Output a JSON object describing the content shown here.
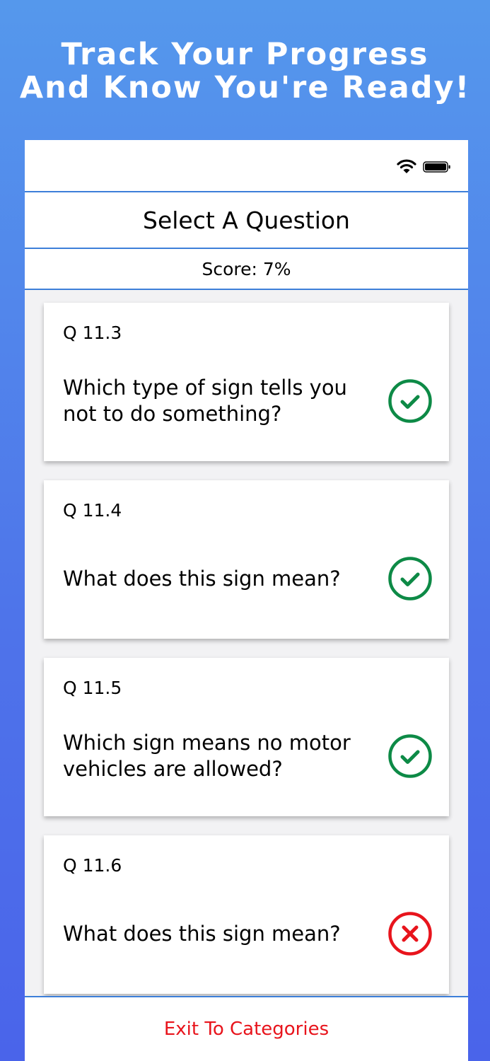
{
  "promo": {
    "headline_line1": "Track Your Progress",
    "headline_line2": "And Know You're Ready!"
  },
  "status_bar": {
    "wifi_icon": "wifi-icon",
    "battery_icon": "battery-icon"
  },
  "header": {
    "title": "Select A Question"
  },
  "score": {
    "text": "Score: 7%"
  },
  "questions": [
    {
      "number": "Q 11.3",
      "line1": "Which type of sign tells you",
      "line2": "not to do something?",
      "result": "correct"
    },
    {
      "number": "Q 11.4",
      "line1": "What does this sign mean?",
      "line2": "",
      "result": "correct"
    },
    {
      "number": "Q 11.5",
      "line1": "Which sign means no motor",
      "line2": "vehicles are allowed?",
      "result": "correct"
    },
    {
      "number": "Q 11.6",
      "line1": "What does this sign mean?",
      "line2": "",
      "result": "incorrect"
    }
  ],
  "footer": {
    "exit_label": "Exit To Categories"
  },
  "colors": {
    "accent_blue": "#3d7fd9",
    "correct_green": "#0d8a46",
    "incorrect_red": "#e8141c",
    "exit_red": "#e8141c"
  }
}
